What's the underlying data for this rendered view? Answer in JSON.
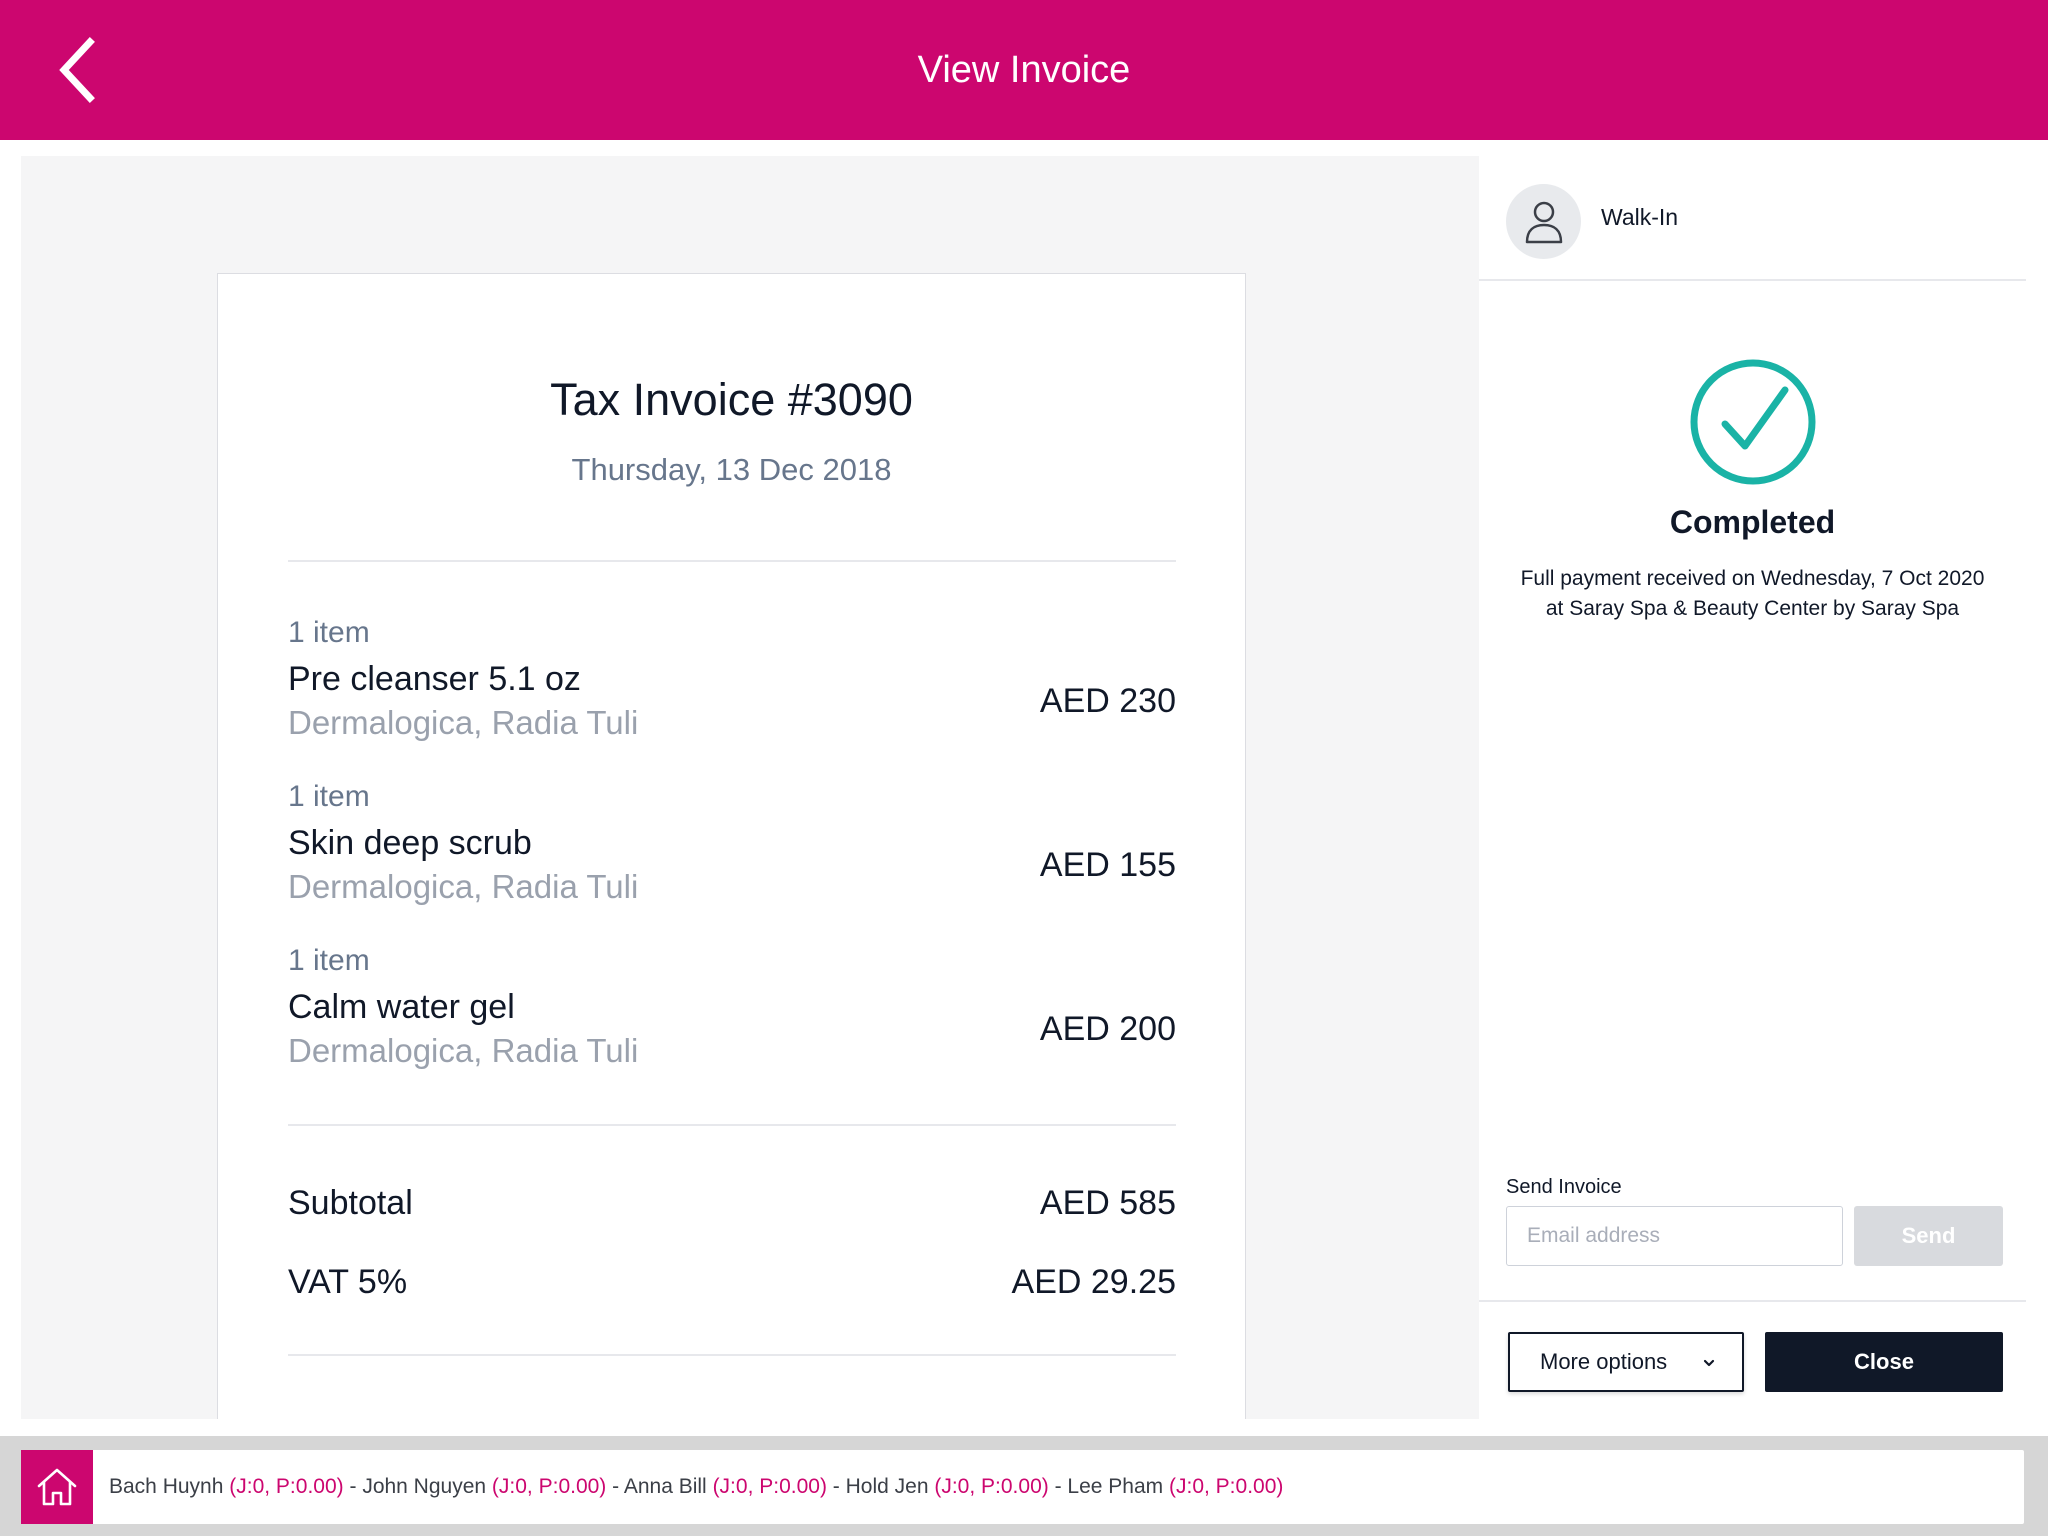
{
  "header": {
    "title": "View Invoice"
  },
  "invoice": {
    "title": "Tax Invoice #3090",
    "date": "Thursday, 13 Dec 2018",
    "items": [
      {
        "qty": "1 item",
        "name": "Pre cleanser 5.1 oz",
        "sub": "Dermalogica, Radia Tuli",
        "price": "AED 230"
      },
      {
        "qty": "1 item",
        "name": "Skin deep scrub",
        "sub": "Dermalogica, Radia Tuli",
        "price": "AED 155"
      },
      {
        "qty": "1 item",
        "name": "Calm water gel",
        "sub": "Dermalogica, Radia Tuli",
        "price": "AED 200"
      }
    ],
    "subtotal_label": "Subtotal",
    "subtotal_value": "AED 585",
    "vat_label": "VAT 5%",
    "vat_value": "AED 29.25"
  },
  "panel": {
    "client_name": "Walk-In",
    "status_title": "Completed",
    "status_desc": "Full payment received on Wednesday, 7 Oct 2020 at Saray Spa & Beauty Center by Saray Spa",
    "send_label": "Send Invoice",
    "email_placeholder": "Email address",
    "send_button": "Send",
    "more_options": "More options",
    "close_button": "Close"
  },
  "staff_bar": {
    "staff": [
      {
        "name": "Bach Huynh",
        "stats": "(J:0, P:0.00)"
      },
      {
        "name": "John Nguyen",
        "stats": "(J:0, P:0.00)"
      },
      {
        "name": "Anna Bill",
        "stats": "(J:0, P:0.00)"
      },
      {
        "name": "Hold Jen",
        "stats": "(J:0, P:0.00)"
      },
      {
        "name": "Lee Pham",
        "stats": "(J:0, P:0.00)"
      }
    ],
    "separator": " - "
  },
  "colors": {
    "brand": "#cc066f",
    "success": "#1ab3a6",
    "dark": "#101828"
  }
}
